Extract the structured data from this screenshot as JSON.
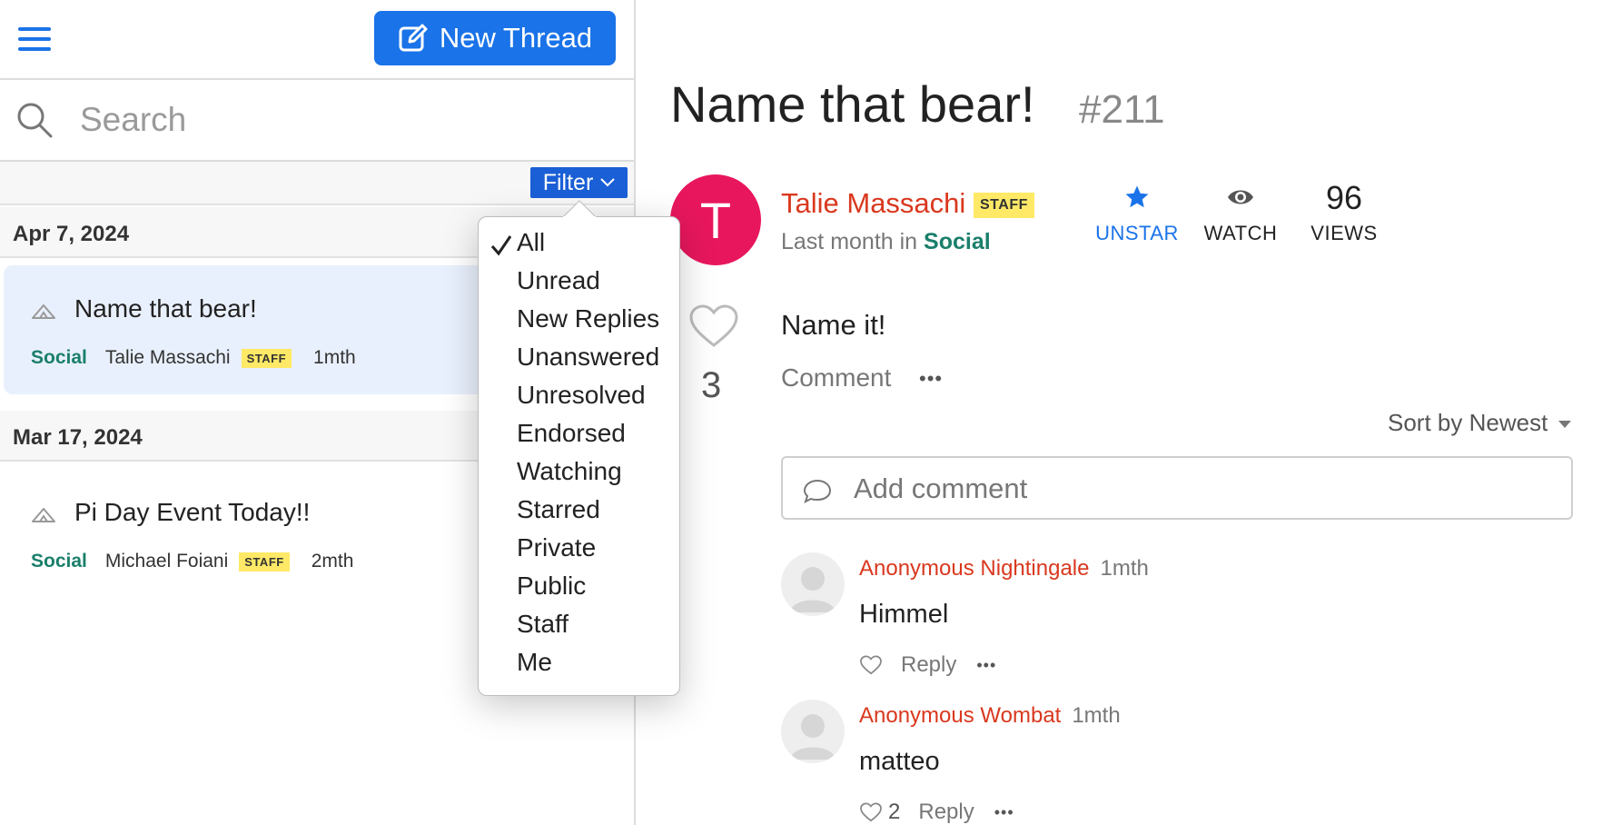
{
  "header": {
    "new_thread_label": "New Thread",
    "search_placeholder": "Search",
    "filter_label": "Filter"
  },
  "filter_menu": {
    "selected": "All",
    "options": [
      "All",
      "Unread",
      "New Replies",
      "Unanswered",
      "Unresolved",
      "Endorsed",
      "Watching",
      "Starred",
      "Private",
      "Public",
      "Staff",
      "Me"
    ]
  },
  "thread_groups": [
    {
      "date": "Apr 7, 2024",
      "threads": [
        {
          "title": "Name that bear!",
          "category": "Social",
          "author": "Talie Massachi",
          "badge": "STAFF",
          "age": "1mth",
          "selected": true
        }
      ]
    },
    {
      "date": "Mar 17, 2024",
      "threads": [
        {
          "title": "Pi Day Event Today!!",
          "category": "Social",
          "author": "Michael Foiani",
          "badge": "STAFF",
          "age": "2mth",
          "selected": false
        }
      ]
    }
  ],
  "thread": {
    "title": "Name that bear!",
    "number": "#211",
    "avatar_letter": "T",
    "author": "Talie Massachi",
    "badge": "STAFF",
    "when_prefix": "Last month in",
    "category": "Social",
    "unstar_label": "UNSTAR",
    "watch_label": "WATCH",
    "views_count": "96",
    "views_label": "VIEWS",
    "like_count": "3",
    "body": "Name it!",
    "comment_label": "Comment",
    "more_label": "•••",
    "sort_label": "Sort by Newest",
    "add_comment_placeholder": "Add comment"
  },
  "comments": [
    {
      "author": "Anonymous Nightingale",
      "time": "1mth",
      "text": "Himmel",
      "likes": "",
      "reply_label": "Reply",
      "more_label": "•••"
    },
    {
      "author": "Anonymous Wombat",
      "time": "1mth",
      "text": "matteo",
      "likes": "2",
      "reply_label": "Reply",
      "more_label": "•••"
    }
  ],
  "colors": {
    "accent": "#1a73e8",
    "category": "#1a7f6b",
    "author": "#d9381e",
    "staff_badge": "#ffe966",
    "avatar": "#e8175d"
  }
}
